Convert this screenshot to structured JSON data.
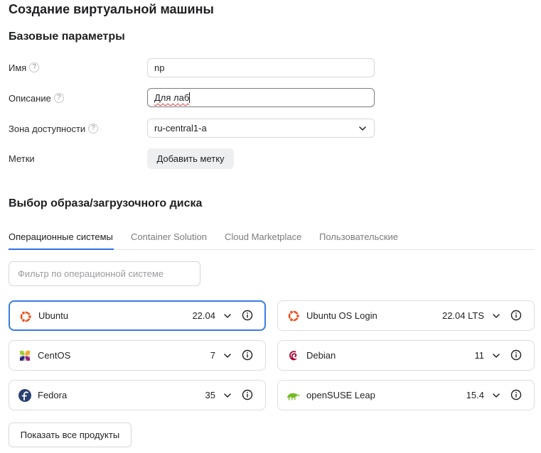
{
  "page_title": "Создание виртуальной машины",
  "base_section": {
    "title": "Базовые параметры",
    "name_label": "Имя",
    "name_value": "np",
    "description_label": "Описание",
    "description_value": "Для лаб",
    "zone_label": "Зона доступности",
    "zone_value": "ru-central1-a",
    "tags_label": "Метки",
    "add_tag_button": "Добавить метку",
    "help_glyph": "?"
  },
  "image_section": {
    "title": "Выбор образа/загрузочного диска",
    "tabs": [
      {
        "label": "Операционные системы",
        "active": true
      },
      {
        "label": "Container Solution",
        "active": false
      },
      {
        "label": "Cloud Marketplace",
        "active": false
      },
      {
        "label": "Пользовательские",
        "active": false
      }
    ],
    "filter_placeholder": "Фильтр по операционной системе",
    "os_cards": [
      {
        "name": "Ubuntu",
        "version": "22.04",
        "icon": "ubuntu-logo-icon",
        "selected": true
      },
      {
        "name": "Ubuntu OS Login",
        "version": "22.04 LTS",
        "icon": "ubuntu-logo-icon",
        "selected": false
      },
      {
        "name": "CentOS",
        "version": "7",
        "icon": "centos-logo-icon",
        "selected": false
      },
      {
        "name": "Debian",
        "version": "11",
        "icon": "debian-logo-icon",
        "selected": false
      },
      {
        "name": "Fedora",
        "version": "35",
        "icon": "fedora-logo-icon",
        "selected": false
      },
      {
        "name": "openSUSE Leap",
        "version": "15.4",
        "icon": "opensuse-logo-icon",
        "selected": false
      }
    ],
    "show_all_button": "Показать все продукты"
  },
  "colors": {
    "accent": "#3b7be8",
    "ubuntu_orange": "#e95420",
    "debian_red": "#a80030",
    "fedora_blue": "#294172",
    "opensuse_green": "#73ba25"
  }
}
